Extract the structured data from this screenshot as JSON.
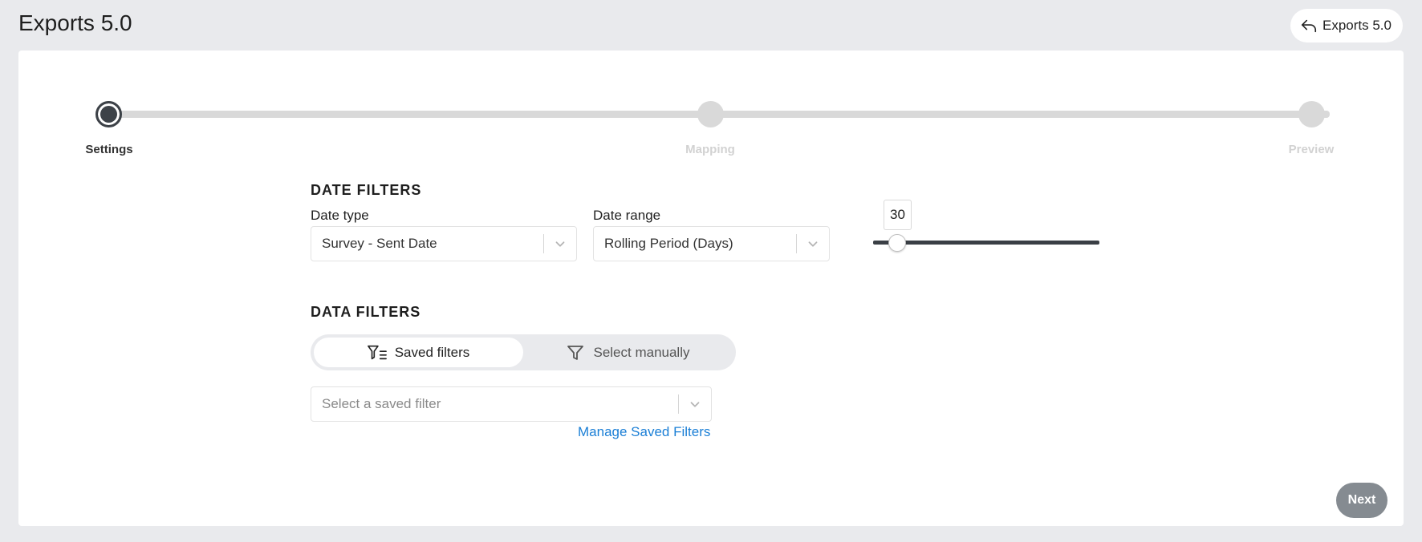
{
  "page": {
    "title": "Exports 5.0"
  },
  "header": {
    "button_label": "Exports 5.0",
    "button_icon": "reply-arrow-icon"
  },
  "stepper": {
    "steps": [
      {
        "label": "Settings",
        "active": true
      },
      {
        "label": "Mapping",
        "active": false
      },
      {
        "label": "Preview",
        "active": false
      }
    ]
  },
  "date_filters": {
    "title": "DATE FILTERS",
    "date_type": {
      "label": "Date type",
      "value": "Survey - Sent Date"
    },
    "date_range": {
      "label": "Date range",
      "value": "Rolling Period (Days)"
    },
    "slider": {
      "value": "30"
    }
  },
  "data_filters": {
    "title": "DATA FILTERS",
    "toggle": {
      "saved_label": "Saved filters",
      "manual_label": "Select manually",
      "selected": "saved"
    },
    "saved_filter": {
      "placeholder": "Select a saved filter"
    },
    "manage_link": "Manage Saved Filters"
  },
  "footer": {
    "next_label": "Next"
  },
  "colors": {
    "accent": "#3d4248",
    "link": "#1b7fd6",
    "next_bg": "#858b91"
  }
}
